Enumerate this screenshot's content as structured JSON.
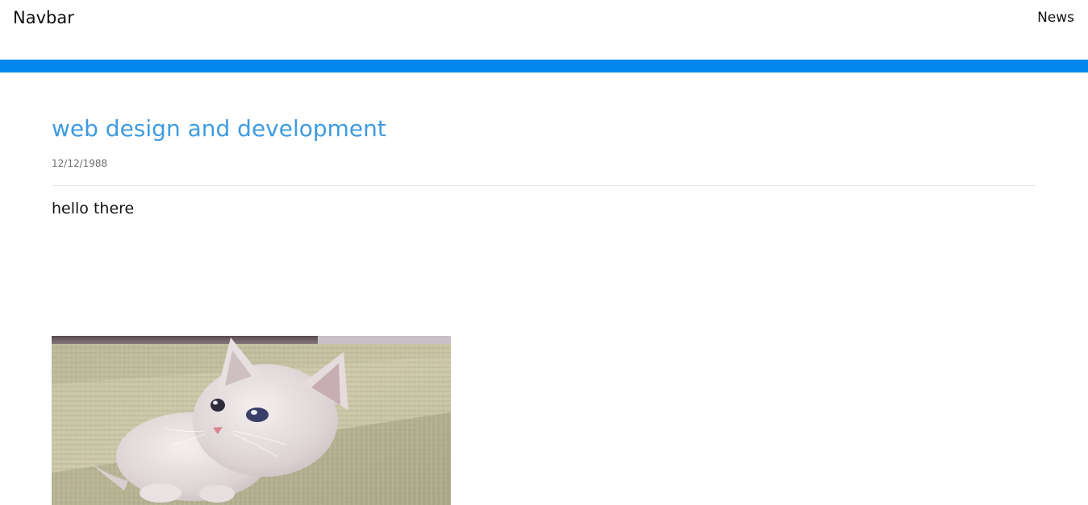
{
  "navbar": {
    "brand": "Navbar",
    "links": [
      {
        "label": "News"
      }
    ]
  },
  "colors": {
    "accent_bar": "#0088ee",
    "title": "#3f9be0"
  },
  "article": {
    "title": "web design and development",
    "date": "12/12/1988",
    "body": "hello there",
    "image": {
      "subject": "kitten-photo"
    }
  }
}
